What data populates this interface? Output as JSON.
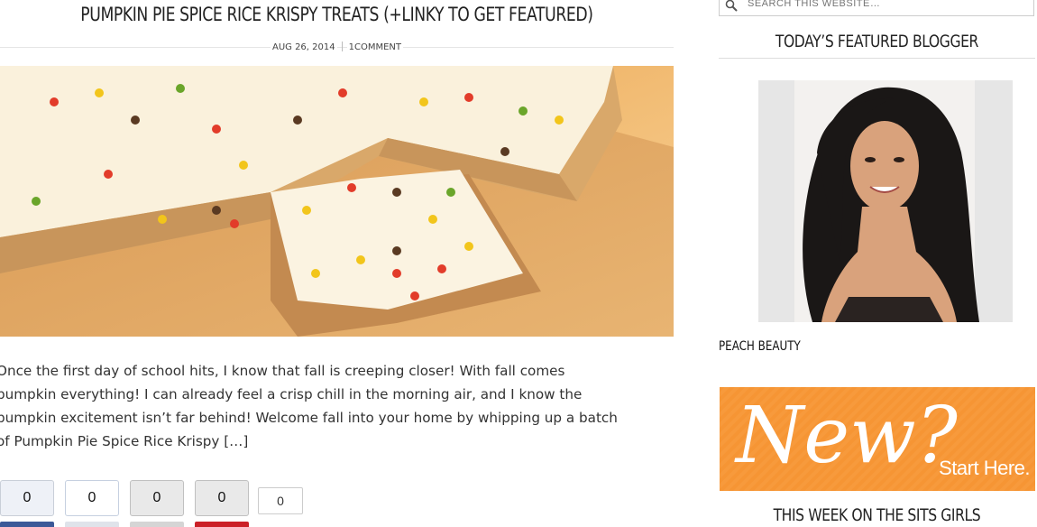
{
  "post": {
    "title": "PUMPKIN PIE SPICE RICE KRISPY TREATS (+LINKY TO GET FEATURED)",
    "date": "AUG 26, 2014",
    "comments": "1COMMENT",
    "excerpt_lines": [
      "Once the first day of school hits, I know that fall is creeping closer! With fall comes",
      "pumpkin everything! I can already feel a crisp chill in the morning air, and I know the",
      "pumpkin excitement isn’t far behind! Welcome fall into your home by whipping up a batch",
      "of Pumpkin Pie Spice Rice Krispy […]"
    ]
  },
  "share": {
    "facebook": "0",
    "twitter": "0",
    "stumble": "0",
    "pinterest": "0",
    "google": "0",
    "colors": {
      "facebook": "#3b5998",
      "pinterest": "#cb2027"
    }
  },
  "sidebar": {
    "search_placeholder": "SEARCH THIS WEBSITE…",
    "featured_title": "TODAY’S FEATURED BLOGGER",
    "featured_name": "PEACH BEAUTY",
    "banner_big": "New?",
    "banner_small": "Start Here.",
    "week_title": "THIS WEEK ON THE SITS GIRLS",
    "banner_color": "#f79a3c"
  }
}
